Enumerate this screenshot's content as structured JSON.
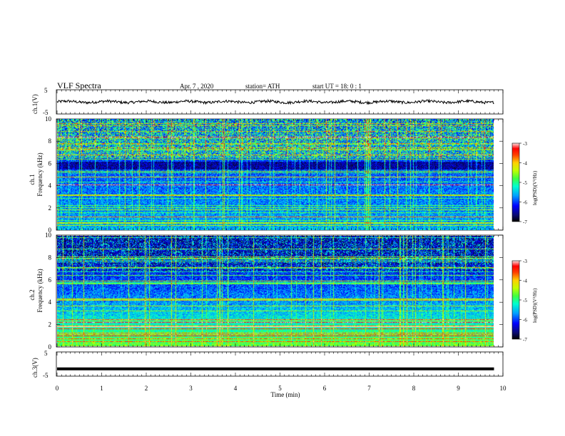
{
  "header": {
    "title": "VLF  Spectra",
    "date": "Apr. 7  , 2020",
    "station": "station= ATH",
    "start": "start  UT  =   18: 0   : 1"
  },
  "colors": {
    "colormap": [
      "#000000",
      "#0a0a6e",
      "#0000ff",
      "#00a0ff",
      "#00ffd0",
      "#40ff40",
      "#c0ff00",
      "#ffd000",
      "#ff4000",
      "#ff0000",
      "#ffe0e0"
    ]
  },
  "chart_data": [
    {
      "type": "line",
      "ylabel": "ch.1(V)",
      "ylim": [
        -5,
        5
      ],
      "yticks": [
        "5",
        "-5"
      ],
      "xlim": [
        0,
        10
      ],
      "note": "voltage trace with small noisy fluctuation around 0 V",
      "trace_level": 0,
      "trace_amplitude": 1
    },
    {
      "type": "heatmap",
      "ylabel_line1": "ch.1",
      "ylabel_line2": "Frequency  (kHz)",
      "ylim": [
        0,
        10
      ],
      "yticks": [
        "0",
        "2",
        "4",
        "6",
        "8",
        "10"
      ],
      "xlim": [
        0,
        9.8
      ],
      "zlim": [
        -7,
        -3
      ],
      "colorbar": {
        "label": "log(PSD)(V²/Hz)",
        "ticks": [
          "-3",
          "-4",
          "-5",
          "-6",
          "-7"
        ]
      }
    },
    {
      "type": "heatmap",
      "ylabel_line1": "ch.2",
      "ylabel_line2": "Frequency  (kHz)",
      "ylim": [
        0,
        10
      ],
      "yticks": [
        "0",
        "2",
        "4",
        "6",
        "8",
        "10"
      ],
      "xlim": [
        0,
        9.8
      ],
      "zlim": [
        -7,
        -3
      ],
      "colorbar": {
        "label": "log(PSD)(V²/Hz)",
        "ticks": [
          "-3",
          "-4",
          "-5",
          "-6",
          "-7"
        ]
      }
    },
    {
      "type": "line",
      "ylabel": "ch.3(V)",
      "ylim": [
        -5,
        5
      ],
      "yticks": [
        "5",
        "-5"
      ],
      "xlim": [
        0,
        10
      ],
      "note": "flat thick trace near -2 V",
      "trace_level": -2
    }
  ],
  "xaxis": {
    "label": "Time  (min)",
    "ticks": [
      "0",
      "1",
      "2",
      "3",
      "4",
      "5",
      "6",
      "7",
      "8",
      "9",
      "10"
    ]
  }
}
